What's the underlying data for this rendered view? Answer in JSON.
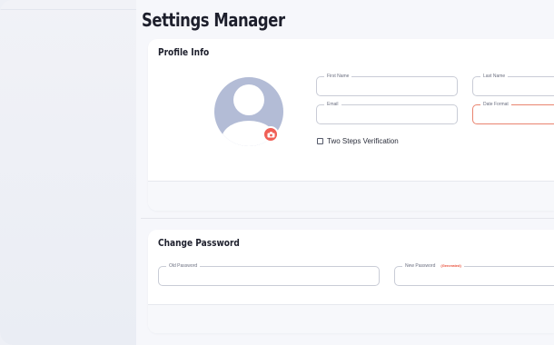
{
  "page": {
    "title": "Settings Manager"
  },
  "profile_card": {
    "title": "Profile Info",
    "fields": {
      "first_name": {
        "label": "First Name",
        "value": ""
      },
      "last_name": {
        "label": "Last Name",
        "value": ""
      },
      "email": {
        "label": "Email",
        "value": ""
      },
      "date_format": {
        "label": "Date Format",
        "value": "",
        "state": "error"
      }
    },
    "two_step": {
      "label": "Two Steps Verification",
      "checked": false
    },
    "avatar": {
      "icon": "user-placeholder-icon",
      "upload_icon": "camera-icon"
    }
  },
  "password_card": {
    "title": "Change Password",
    "fields": {
      "old_password": {
        "label": "Old Password",
        "value": ""
      },
      "new_password": {
        "label": "New Password",
        "tag": "(Generated)",
        "value": ""
      }
    }
  },
  "colors": {
    "accent": "#f05f56",
    "avatar": "#b3bcd6",
    "error_border": "#e9846f"
  }
}
